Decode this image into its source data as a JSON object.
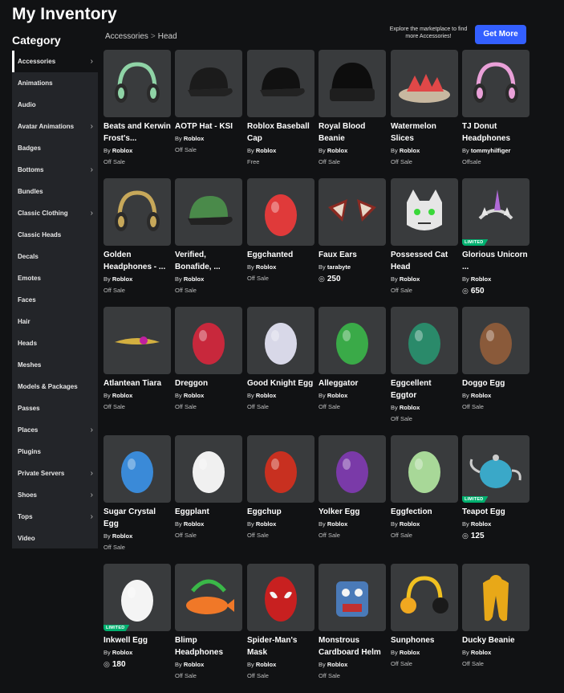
{
  "page": {
    "title": "My Inventory",
    "category_heading": "Category",
    "breadcrumb": [
      "Accessories",
      "Head"
    ],
    "breadcrumb_separator": ">",
    "promo_text": "Explore the marketplace to find more Accessories!",
    "get_more_label": "Get More"
  },
  "sidebar": {
    "items": [
      {
        "label": "Accessories",
        "has_chevron": true,
        "active": true
      },
      {
        "label": "Animations",
        "has_chevron": false
      },
      {
        "label": "Audio",
        "has_chevron": false
      },
      {
        "label": "Avatar Animations",
        "has_chevron": true
      },
      {
        "label": "Badges",
        "has_chevron": false
      },
      {
        "label": "Bottoms",
        "has_chevron": true
      },
      {
        "label": "Bundles",
        "has_chevron": false
      },
      {
        "label": "Classic Clothing",
        "has_chevron": true
      },
      {
        "label": "Classic Heads",
        "has_chevron": false
      },
      {
        "label": "Decals",
        "has_chevron": false
      },
      {
        "label": "Emotes",
        "has_chevron": false
      },
      {
        "label": "Faces",
        "has_chevron": false
      },
      {
        "label": "Hair",
        "has_chevron": false
      },
      {
        "label": "Heads",
        "has_chevron": false
      },
      {
        "label": "Meshes",
        "has_chevron": false
      },
      {
        "label": "Models & Packages",
        "has_chevron": false
      },
      {
        "label": "Passes",
        "has_chevron": false
      },
      {
        "label": "Places",
        "has_chevron": true
      },
      {
        "label": "Plugins",
        "has_chevron": false
      },
      {
        "label": "Private Servers",
        "has_chevron": true
      },
      {
        "label": "Shoes",
        "has_chevron": true
      },
      {
        "label": "Tops",
        "has_chevron": true
      },
      {
        "label": "Video",
        "has_chevron": false
      }
    ],
    "chevron_glyph": "›"
  },
  "items": [
    {
      "name": "Beats and Kerwin Frost's...",
      "by": "By",
      "creator": "Roblox",
      "price": "Off Sale",
      "robux": false,
      "limited": false,
      "icon": "headphones-icon",
      "color": "#8fd3a6"
    },
    {
      "name": "AOTP Hat - KSI",
      "by": "By",
      "creator": "Roblox",
      "price": "Off Sale",
      "robux": false,
      "limited": false,
      "icon": "cap-icon",
      "color": "#1b1b1b"
    },
    {
      "name": "Roblox Baseball Cap",
      "by": "By",
      "creator": "Roblox",
      "price": "Free",
      "robux": false,
      "limited": false,
      "icon": "cap-icon",
      "color": "#111111"
    },
    {
      "name": "Royal Blood Beanie",
      "by": "By",
      "creator": "Roblox",
      "price": "Off Sale",
      "robux": false,
      "limited": false,
      "icon": "beanie-icon",
      "color": "#0d0d0d"
    },
    {
      "name": "Watermelon Slices",
      "by": "By",
      "creator": "Roblox",
      "price": "Off Sale",
      "robux": false,
      "limited": false,
      "icon": "watermelon-icon",
      "color": "#e04848"
    },
    {
      "name": "TJ Donut Headphones",
      "by": "By",
      "creator": "tommyhilfiger",
      "price": "Offsale",
      "robux": false,
      "limited": false,
      "icon": "headphones-icon",
      "color": "#e9a0d8"
    },
    {
      "name": "Golden Headphones - ...",
      "by": "By",
      "creator": "Roblox",
      "price": "Off Sale",
      "robux": false,
      "limited": false,
      "icon": "headphones-icon",
      "color": "#c7a85a"
    },
    {
      "name": "Verified, Bonafide, ...",
      "by": "By",
      "creator": "Roblox",
      "price": "Off Sale",
      "robux": false,
      "limited": false,
      "icon": "cap-icon",
      "color": "#4a8a4a"
    },
    {
      "name": "Eggchanted",
      "by": "By",
      "creator": "Roblox",
      "price": "Off Sale",
      "robux": false,
      "limited": false,
      "icon": "egg-icon",
      "color": "#e03a3a"
    },
    {
      "name": "Faux Ears",
      "by": "By",
      "creator": "tarabyte",
      "price": "250",
      "robux": true,
      "limited": false,
      "icon": "ears-icon",
      "color": "#8a2a22"
    },
    {
      "name": "Possessed Cat Head",
      "by": "By",
      "creator": "Roblox",
      "price": "Off Sale",
      "robux": false,
      "limited": false,
      "icon": "cat-icon",
      "color": "#e6e6e6"
    },
    {
      "name": "Glorious Unicorn ...",
      "by": "By",
      "creator": "Roblox",
      "price": "650",
      "robux": true,
      "limited": true,
      "icon": "unicorn-icon",
      "color": "#b06ad8"
    },
    {
      "name": "Atlantean Tiara",
      "by": "By",
      "creator": "Roblox",
      "price": "Off Sale",
      "robux": false,
      "limited": false,
      "icon": "tiara-icon",
      "color": "#d4b040"
    },
    {
      "name": "Dreggon",
      "by": "By",
      "creator": "Roblox",
      "price": "Off Sale",
      "robux": false,
      "limited": false,
      "icon": "egg-icon",
      "color": "#c8283c"
    },
    {
      "name": "Good Knight Egg",
      "by": "By",
      "creator": "Roblox",
      "price": "Off Sale",
      "robux": false,
      "limited": false,
      "icon": "egg-icon",
      "color": "#d8d8e8"
    },
    {
      "name": "Alleggator",
      "by": "By",
      "creator": "Roblox",
      "price": "Off Sale",
      "robux": false,
      "limited": false,
      "icon": "egg-icon",
      "color": "#3aaa48"
    },
    {
      "name": "Eggcellent Eggtor",
      "by": "By",
      "creator": "Roblox",
      "price": "Off Sale",
      "robux": false,
      "limited": false,
      "icon": "egg-icon",
      "color": "#2a8a6a"
    },
    {
      "name": "Doggo Egg",
      "by": "By",
      "creator": "Roblox",
      "price": "Off Sale",
      "robux": false,
      "limited": false,
      "icon": "egg-icon",
      "color": "#8a5a3a"
    },
    {
      "name": "Sugar Crystal Egg",
      "by": "By",
      "creator": "Roblox",
      "price": "Off Sale",
      "robux": false,
      "limited": false,
      "icon": "egg-icon",
      "color": "#3a8ad8"
    },
    {
      "name": "Eggplant",
      "by": "By",
      "creator": "Roblox",
      "price": "Off Sale",
      "robux": false,
      "limited": false,
      "icon": "egg-icon",
      "color": "#f0f0f0"
    },
    {
      "name": "Eggchup",
      "by": "By",
      "creator": "Roblox",
      "price": "Off Sale",
      "robux": false,
      "limited": false,
      "icon": "egg-icon",
      "color": "#c83020"
    },
    {
      "name": "Yolker Egg",
      "by": "By",
      "creator": "Roblox",
      "price": "Off Sale",
      "robux": false,
      "limited": false,
      "icon": "egg-icon",
      "color": "#7a3aa8"
    },
    {
      "name": "Eggfection",
      "by": "By",
      "creator": "Roblox",
      "price": "Off Sale",
      "robux": false,
      "limited": false,
      "icon": "egg-icon",
      "color": "#a8d898"
    },
    {
      "name": "Teapot Egg",
      "by": "By",
      "creator": "Roblox",
      "price": "125",
      "robux": true,
      "limited": true,
      "icon": "teapot-icon",
      "color": "#3aa8c8"
    },
    {
      "name": "Inkwell Egg",
      "by": "By",
      "creator": "Roblox",
      "price": "180",
      "robux": true,
      "limited": true,
      "icon": "egg-icon",
      "color": "#f4f4f4"
    },
    {
      "name": "Blimp Headphones",
      "by": "By",
      "creator": "Roblox",
      "price": "Off Sale",
      "robux": false,
      "limited": false,
      "icon": "blimp-icon",
      "color": "#f07828"
    },
    {
      "name": "Spider-Man's Mask",
      "by": "By",
      "creator": "Roblox",
      "price": "Off Sale",
      "robux": false,
      "limited": false,
      "icon": "mask-icon",
      "color": "#c82020"
    },
    {
      "name": "Monstrous Cardboard Helm",
      "by": "By",
      "creator": "Roblox",
      "price": "Off Sale",
      "robux": false,
      "limited": false,
      "icon": "helm-icon",
      "color": "#4a7ab8"
    },
    {
      "name": "Sunphones",
      "by": "By",
      "creator": "Roblox",
      "price": "Off Sale",
      "robux": false,
      "limited": false,
      "icon": "sunphones-icon",
      "color": "#f0a820"
    },
    {
      "name": "Ducky Beanie",
      "by": "By",
      "creator": "Roblox",
      "price": "Off Sale",
      "robux": false,
      "limited": false,
      "icon": "duck-icon",
      "color": "#e8a818"
    }
  ],
  "limited_label": "LIMITED",
  "robux_glyph": "◎"
}
